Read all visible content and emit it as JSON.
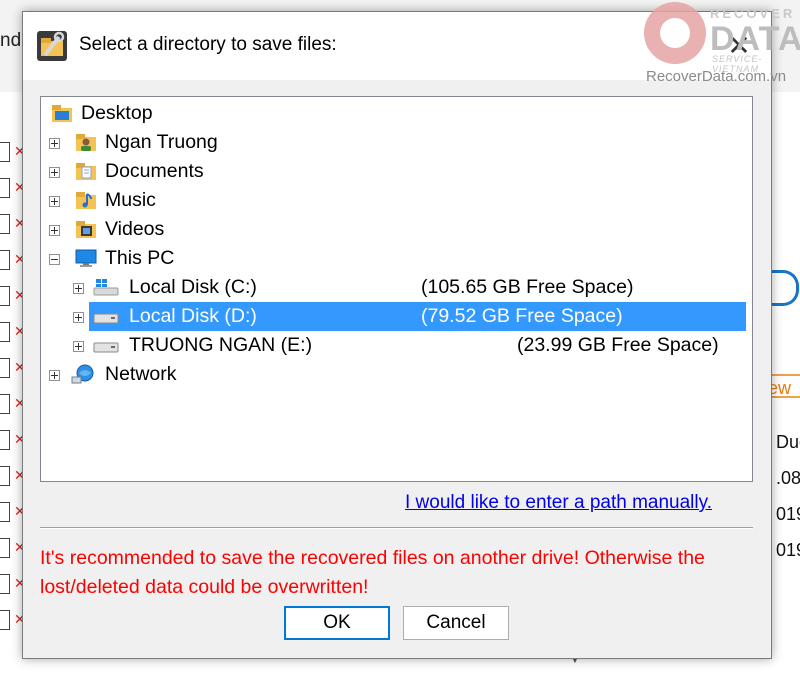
{
  "background": {
    "toolbar_partial_text": "nd",
    "right_partial_texts": [
      "ew",
      "Duon",
      ".08",
      "019",
      "019"
    ]
  },
  "watermark": {
    "recover": "RECOVER",
    "data": "DATA",
    "service": "SERVICE-VIETNAM",
    "site": "RecoverData.com.vn"
  },
  "dialog": {
    "title": "Select a directory to save files:",
    "close_glyph": "✕",
    "tree": {
      "desktop": "Desktop",
      "user": "Ngan Truong",
      "documents": "Documents",
      "music": "Music",
      "videos": "Videos",
      "this_pc": "This PC",
      "drives": [
        {
          "label": "Local Disk (C:)",
          "free": "(105.65 GB Free Space)"
        },
        {
          "label": "Local Disk (D:)",
          "free": "(79.52 GB Free Space)"
        },
        {
          "label": "TRUONG NGAN (E:)",
          "free": "(23.99 GB Free Space)"
        }
      ],
      "network": "Network"
    },
    "manual_link": "I would like to enter a path manually.",
    "warning": "It's recommended to save the recovered files on another drive! Otherwise the lost/deleted data could be overwritten!",
    "ok_label": "OK",
    "cancel_label": "Cancel"
  },
  "colors": {
    "selection": "#3399ff",
    "warning": "#ff0000",
    "link": "#0000ee",
    "default_button_border": "#0078d7"
  },
  "icons": {
    "title": "folder-wrench-icon",
    "desktop": "desktop-folder-icon",
    "user": "user-folder-icon",
    "documents": "documents-folder-icon",
    "music": "music-folder-icon",
    "videos": "videos-folder-icon",
    "this_pc": "monitor-icon",
    "drive_c": "windows-drive-icon",
    "drive": "hard-drive-icon",
    "network": "network-globe-icon"
  }
}
